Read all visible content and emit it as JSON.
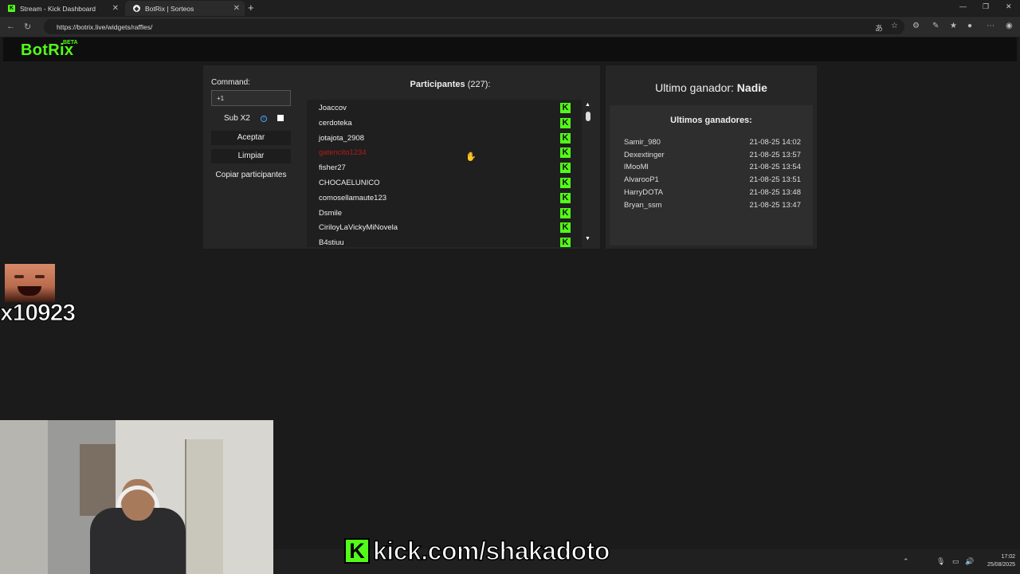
{
  "browser": {
    "tabs": [
      {
        "label": "Stream - Kick Dashboard",
        "icon": "kick-icon"
      },
      {
        "label": "BotRix | Sorteos",
        "icon": "botrix-icon"
      }
    ],
    "url": "https://botrix.live/widgets/raffles/"
  },
  "site": {
    "logo": "BotRix",
    "beta": "BETA"
  },
  "raffle": {
    "command_label": "Command:",
    "command_value": "+1",
    "sub_label": "Sub X2",
    "accept_label": "Aceptar",
    "clear_label": "Limpiar",
    "copy_label": "Copiar participantes",
    "participants_title": "Participantes",
    "participants_count": "(227):",
    "participants": [
      {
        "name": "Joaccov",
        "highlight": false
      },
      {
        "name": "cerdoteka",
        "highlight": false
      },
      {
        "name": "jotajota_2908",
        "highlight": false
      },
      {
        "name": "gatencito1234",
        "highlight": true
      },
      {
        "name": "fisher27",
        "highlight": false
      },
      {
        "name": "CHOCAELUNICO",
        "highlight": false
      },
      {
        "name": "comosellamaute123",
        "highlight": false
      },
      {
        "name": "Dsmile",
        "highlight": false
      },
      {
        "name": "CiriloyLaVickyMiNovela",
        "highlight": false
      },
      {
        "name": "B4stiuu",
        "highlight": false
      }
    ],
    "badge_letter": "K"
  },
  "winners": {
    "last_label": "Ultimo ganador:",
    "last_value": "Nadie",
    "list_title": "Ultimos ganadores:",
    "list": [
      {
        "name": "Samir_980",
        "date": "21-08-25 14:02"
      },
      {
        "name": "Dexextinger",
        "date": "21-08-25 13:57"
      },
      {
        "name": "lMooMl",
        "date": "21-08-25 13:54"
      },
      {
        "name": "AlvarooP1",
        "date": "21-08-25 13:51"
      },
      {
        "name": "HarryDOTA",
        "date": "21-08-25 13:48"
      },
      {
        "name": "Bryan_ssm",
        "date": "21-08-25 13:47"
      }
    ]
  },
  "overlay": {
    "counter": "x10923",
    "banner_k": "K",
    "banner_text": "kick.com/shakadoto"
  },
  "taskbar": {
    "time": "17:02",
    "date": "25/08/2025"
  },
  "colors": {
    "accent": "#53fc18",
    "highlight_name": "#b31b1b",
    "background": "#1b1b1b",
    "panel": "#262626"
  }
}
